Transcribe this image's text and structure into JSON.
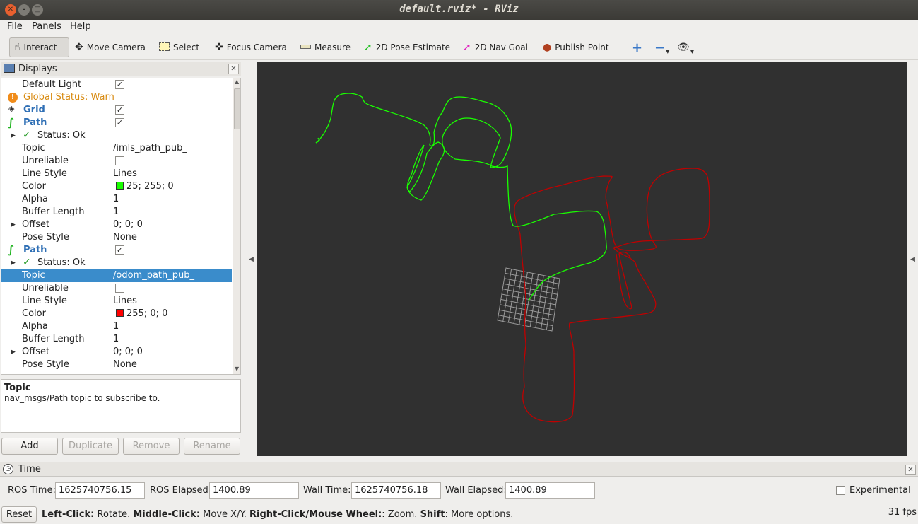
{
  "window": {
    "title": "default.rviz* - RViz"
  },
  "menu": {
    "file": "File",
    "panels": "Panels",
    "help": "Help"
  },
  "toolbar": {
    "interact": "Interact",
    "move_camera": "Move Camera",
    "select": "Select",
    "focus_camera": "Focus Camera",
    "measure": "Measure",
    "pose_estimate": "2D Pose Estimate",
    "nav_goal": "2D Nav Goal",
    "publish_point": "Publish Point"
  },
  "displays": {
    "title": "Displays",
    "rows": [
      {
        "key": "Default Light",
        "checked": true
      },
      {
        "key": "Global Status: Warn"
      },
      {
        "key": "Grid",
        "checked": true
      },
      {
        "key": "Path",
        "checked": true
      },
      {
        "key": "Status: Ok"
      },
      {
        "key": "Topic",
        "value": "/imls_path_pub_"
      },
      {
        "key": "Unreliable",
        "checked": false
      },
      {
        "key": "Line Style",
        "value": "Lines"
      },
      {
        "key": "Color",
        "value": "25; 255; 0",
        "color": "#19ff00"
      },
      {
        "key": "Alpha",
        "value": "1"
      },
      {
        "key": "Buffer Length",
        "value": "1"
      },
      {
        "key": "Offset",
        "value": "0; 0; 0"
      },
      {
        "key": "Pose Style",
        "value": "None"
      },
      {
        "key": "Path",
        "checked": true
      },
      {
        "key": "Status: Ok"
      },
      {
        "key": "Topic",
        "value": "/odom_path_pub_"
      },
      {
        "key": "Unreliable",
        "checked": false
      },
      {
        "key": "Line Style",
        "value": "Lines"
      },
      {
        "key": "Color",
        "value": "255; 0; 0",
        "color": "#ff0000"
      },
      {
        "key": "Alpha",
        "value": "1"
      },
      {
        "key": "Buffer Length",
        "value": "1"
      },
      {
        "key": "Offset",
        "value": "0; 0; 0"
      },
      {
        "key": "Pose Style",
        "value": "None"
      }
    ],
    "desc_title": "Topic",
    "desc_text": "nav_msgs/Path topic to subscribe to.",
    "buttons": {
      "add": "Add",
      "duplicate": "Duplicate",
      "remove": "Remove",
      "rename": "Rename"
    }
  },
  "time": {
    "title": "Time",
    "ros_time_label": "ROS Time:",
    "ros_time": "1625740756.15",
    "ros_elapsed_label": "ROS Elapsed:",
    "ros_elapsed": "1400.89",
    "wall_time_label": "Wall Time:",
    "wall_time": "1625740756.18",
    "wall_elapsed_label": "Wall Elapsed:",
    "wall_elapsed": "1400.89",
    "experimental": "Experimental"
  },
  "status": {
    "reset": "Reset",
    "hint_lc": "Left-Click:",
    "hint_lc_t": " Rotate. ",
    "hint_mc": "Middle-Click:",
    "hint_mc_t": " Move X/Y. ",
    "hint_rc": "Right-Click/Mouse Wheel:",
    "hint_rc_t": ": Zoom. ",
    "hint_sh": "Shift",
    "hint_sh_t": ": More options.",
    "fps": "31 fps"
  },
  "colors": {
    "green_path": "#19ff00",
    "red_path": "#cc0000",
    "grid": "#a0a0a0",
    "selection": "#3a8ccb"
  }
}
